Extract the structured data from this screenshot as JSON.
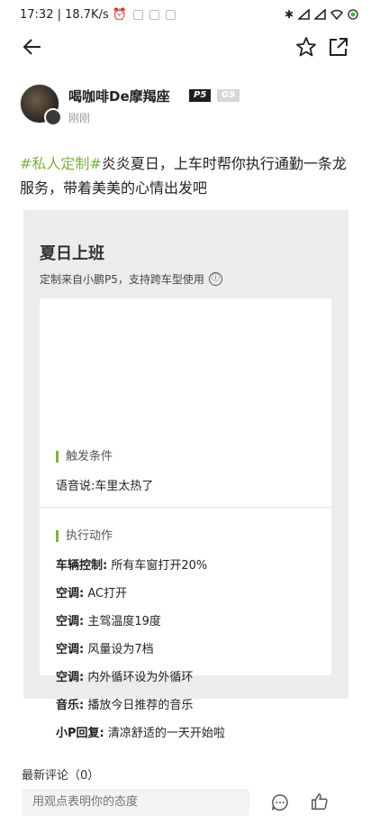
{
  "status_bar": {
    "time_speed": "17:32 | 18.7K/s",
    "icons": [
      "alarm-icon",
      "app-notification-icons",
      "bluetooth-icon",
      "signal-icon",
      "signal-icon",
      "wifi-icon",
      "battery-icon"
    ]
  },
  "topbar": {
    "icons": [
      "back-arrow-icon",
      "star-icon",
      "share-icon"
    ]
  },
  "author": {
    "name": "喝咖啡De摩羯座",
    "tag_p5": "P5",
    "tag_g9": "G9",
    "time": "刚刚"
  },
  "post": {
    "hashtag": "#私人定制#",
    "text": "炎炎夏日，上车时帮你执行通勤一条龙服务，带着美美的心情出发吧"
  },
  "card": {
    "title": "夏日上班",
    "subtitle": "定制来自小鹏P5，支持跨车型使用",
    "info_icon": "ⓘ",
    "trigger_label": "触发条件",
    "trigger_text": "语音说:车里太热了",
    "actions_label": "执行动作",
    "actions": [
      {
        "k": "车辆控制:",
        "v": " 所有车窗打开20%"
      },
      {
        "k": "空调:",
        "v": " AC打开"
      },
      {
        "k": "空调:",
        "v": " 主驾温度19度"
      },
      {
        "k": "空调:",
        "v": " 风量设为7档"
      },
      {
        "k": "空调:",
        "v": " 内外循环设为外循环"
      },
      {
        "k": "音乐:",
        "v": " 播放今日推荐的音乐"
      },
      {
        "k": "小P回复:",
        "v": " 清凉舒适的一天开始啦"
      }
    ]
  },
  "comments": {
    "title": "最新评论（0）",
    "placeholder": "用观点表明你的态度"
  },
  "colors": {
    "accent": "#7cb342",
    "card_bg": "#ececec"
  }
}
